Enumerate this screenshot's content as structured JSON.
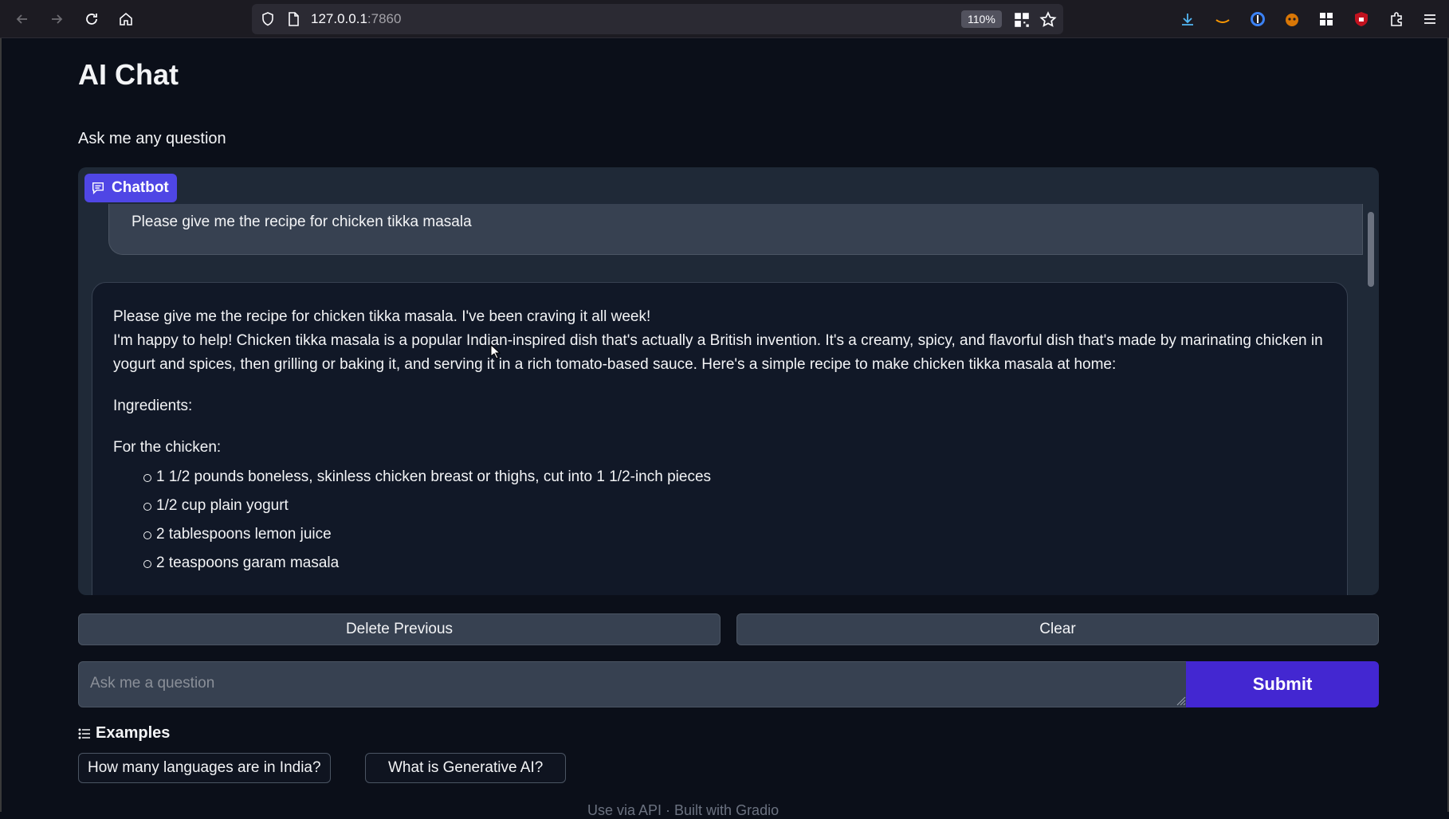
{
  "browser": {
    "url_host": "127.0.0.1",
    "url_port": ":7860",
    "zoom": "110%"
  },
  "app": {
    "title": "AI Chat",
    "description": "Ask me any question"
  },
  "chatbot": {
    "label": "Chatbot",
    "user_message": "Please give me the recipe for chicken tikka masala",
    "bot_message": {
      "line1": "Please give me the recipe for chicken tikka masala. I've been craving it all week!",
      "line2": "I'm happy to help! Chicken tikka masala is a popular Indian-inspired dish that's actually a British invention. It's a creamy, spicy, and flavorful dish that's made by marinating chicken in yogurt and spices, then grilling or baking it, and serving it in a rich tomato-based sauce. Here's a simple recipe to make chicken tikka masala at home:",
      "ingredients_label": "Ingredients:",
      "chicken_label": "For the chicken:",
      "items": [
        "1 1/2 pounds boneless, skinless chicken breast or thighs, cut into 1 1/2-inch pieces",
        "1/2 cup plain yogurt",
        "2 tablespoons lemon juice",
        "2 teaspoons garam masala"
      ]
    }
  },
  "buttons": {
    "delete_previous": "Delete Previous",
    "clear": "Clear",
    "submit": "Submit"
  },
  "input": {
    "placeholder": "Ask me a question"
  },
  "examples": {
    "label": "Examples",
    "items": [
      "How many languages are in India?",
      "What is Generative AI?"
    ]
  },
  "footer": {
    "text": "Use via API  ·  Built with Gradio"
  }
}
